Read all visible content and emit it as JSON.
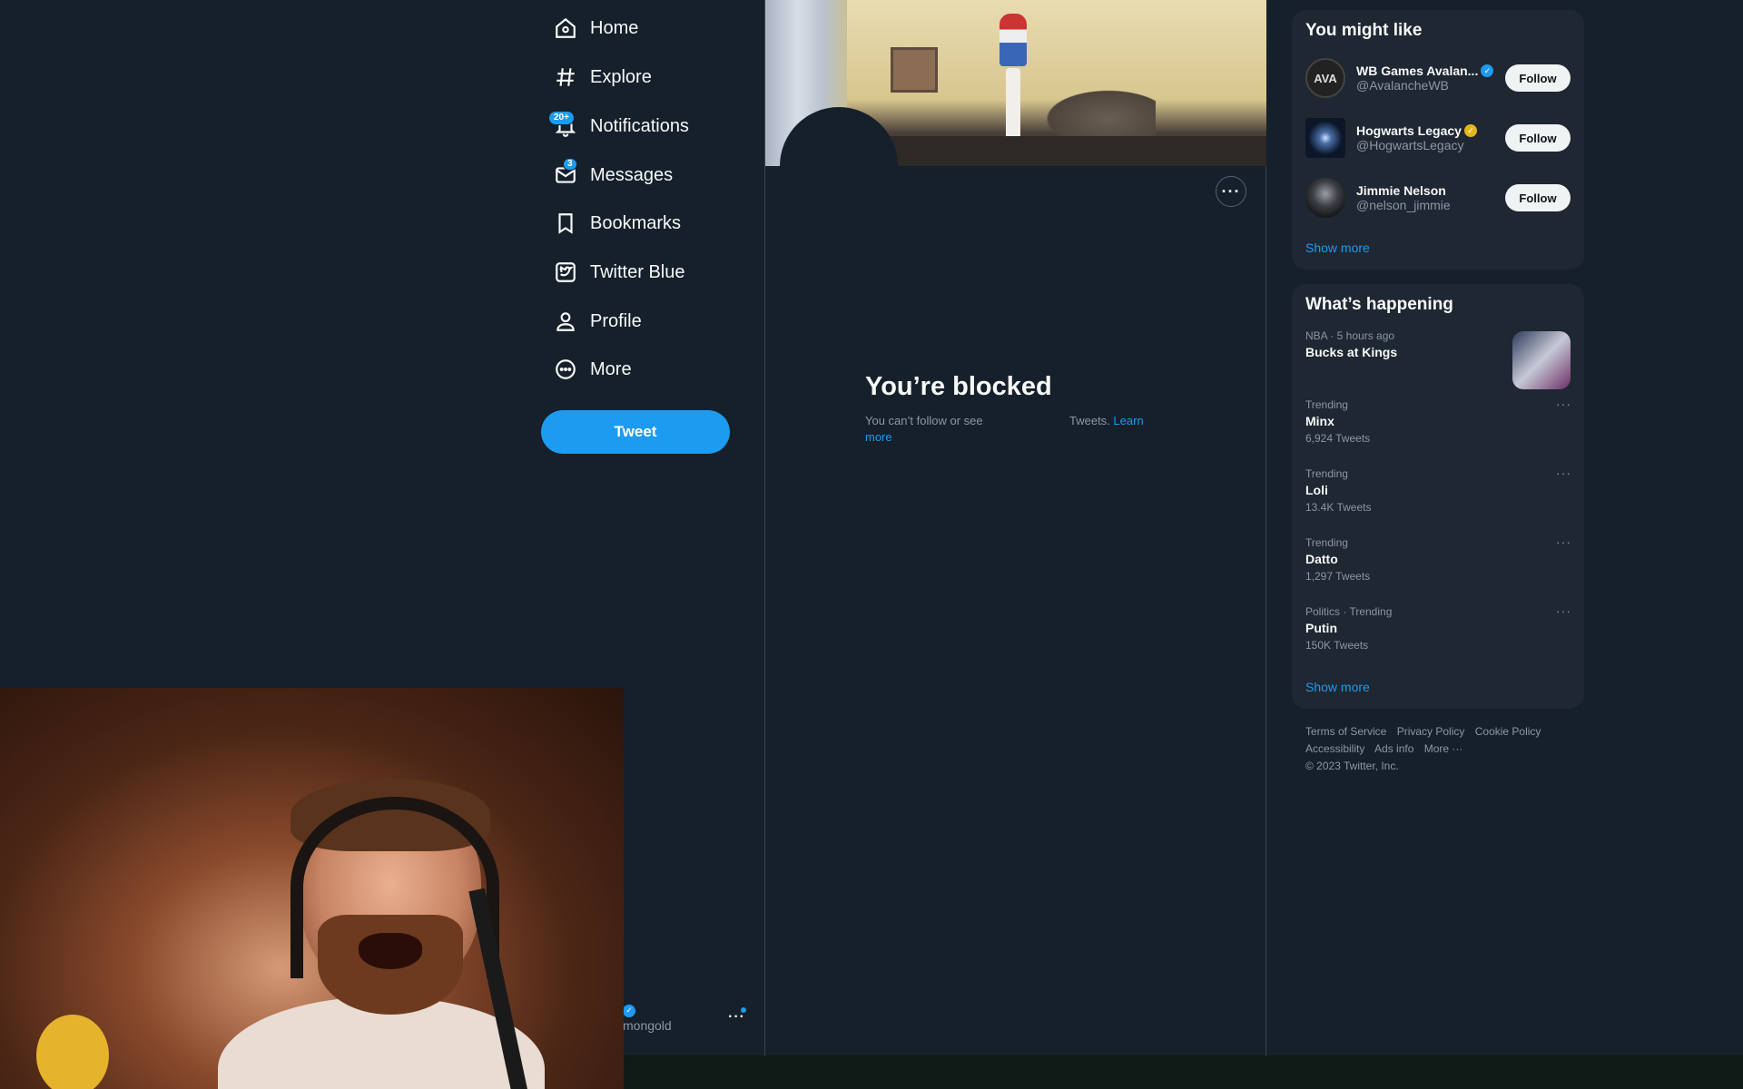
{
  "nav": {
    "items": [
      {
        "label": "Home",
        "icon": "home-icon"
      },
      {
        "label": "Explore",
        "icon": "hashtag-icon"
      },
      {
        "label": "Notifications",
        "icon": "bell-icon",
        "badge": "20+"
      },
      {
        "label": "Messages",
        "icon": "envelope-icon",
        "badge": "3"
      },
      {
        "label": "Bookmarks",
        "icon": "bookmark-icon"
      },
      {
        "label": "Twitter Blue",
        "icon": "twitter-blue-icon"
      },
      {
        "label": "Profile",
        "icon": "person-icon"
      },
      {
        "label": "More",
        "icon": "more-circle-icon"
      }
    ],
    "tweet_label": "Tweet"
  },
  "main": {
    "more_label": "···",
    "blocked_title": "You’re blocked",
    "blocked_text": "You can’t follow or see",
    "blocked_text_2": "Tweets.",
    "learn_more": "Learn",
    "learn_more_2": "more"
  },
  "who_to_follow": {
    "title": "You might like",
    "accounts": [
      {
        "name": "WB Games Avalan...",
        "handle": "@AvalancheWB",
        "avatar_text": "AVA",
        "verified": "blue",
        "follow": "Follow"
      },
      {
        "name": "Hogwarts Legacy",
        "handle": "@HogwartsLegacy",
        "avatar_text": "",
        "verified": "gold",
        "follow": "Follow"
      },
      {
        "name": "Jimmie Nelson",
        "handle": "@nelson_jimmie",
        "avatar_text": "",
        "verified": "none",
        "follow": "Follow"
      }
    ],
    "show_more": "Show more"
  },
  "whats_happening": {
    "title": "What’s happening",
    "featured": {
      "meta": "NBA · 5 hours ago",
      "topic": "Bucks at Kings"
    },
    "trends": [
      {
        "meta": "Trending",
        "topic": "Minx",
        "count": "6,924 Tweets"
      },
      {
        "meta": "Trending",
        "topic": "Loli",
        "count": "13.4K Tweets"
      },
      {
        "meta": "Trending",
        "topic": "Datto",
        "count": "1,297 Tweets"
      },
      {
        "meta": "Politics · Trending",
        "topic": "Putin",
        "count": "150K Tweets"
      }
    ],
    "show_more": "Show more"
  },
  "footer": {
    "links": [
      "Terms of Service",
      "Privacy Policy",
      "Cookie Policy",
      "Accessibility",
      "Ads info",
      "More ···"
    ],
    "copyright": "© 2023 Twitter, Inc."
  },
  "account": {
    "name": "",
    "handle": "mongold",
    "dots": "···"
  },
  "colors": {
    "background": "#15202b",
    "accent": "#1d9bf0",
    "card": "#1e2732",
    "muted": "#8b98a5",
    "verified_gold": "#e2b719"
  }
}
